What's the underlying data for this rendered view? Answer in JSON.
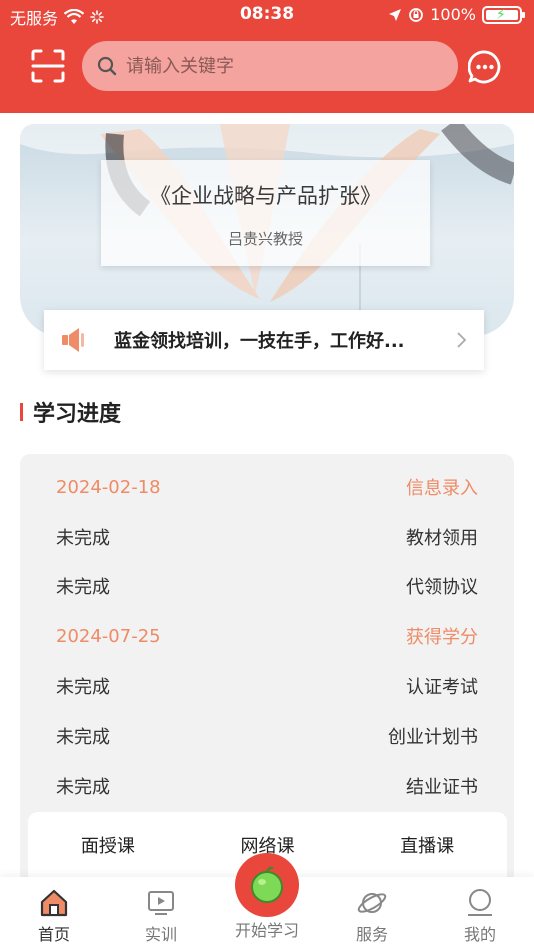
{
  "status_bar": {
    "carrier": "无服务",
    "time": "08:38",
    "battery": "100%"
  },
  "search": {
    "placeholder": "请输入关键字"
  },
  "banner": {
    "title": "《企业战略与产品扩张》",
    "subtitle": "吕贵兴教授"
  },
  "notice": {
    "text": "蓝金领找培训，一技在手，工作好..."
  },
  "progress_section": {
    "title": "学习进度",
    "rows": [
      {
        "left": "2024-02-18",
        "right": "信息录入",
        "accent": true
      },
      {
        "left": "未完成",
        "right": "教材领用",
        "accent": false
      },
      {
        "left": "未完成",
        "right": "代领协议",
        "accent": false
      },
      {
        "left": "2024-07-25",
        "right": "获得学分",
        "accent": true
      },
      {
        "left": "未完成",
        "right": "认证考试",
        "accent": false
      },
      {
        "left": "未完成",
        "right": "创业计划书",
        "accent": false
      },
      {
        "left": "未完成",
        "right": "结业证书",
        "accent": false
      }
    ]
  },
  "course_tabs": [
    "面授课",
    "网络课",
    "直播课"
  ],
  "bottom_nav": {
    "home": "首页",
    "practice": "实训",
    "start": "开始学习",
    "service": "服务",
    "mine": "我的"
  },
  "colors": {
    "brand": "#e9473c",
    "accent": "#ef8b66",
    "card_bg": "#f2f2f2"
  }
}
